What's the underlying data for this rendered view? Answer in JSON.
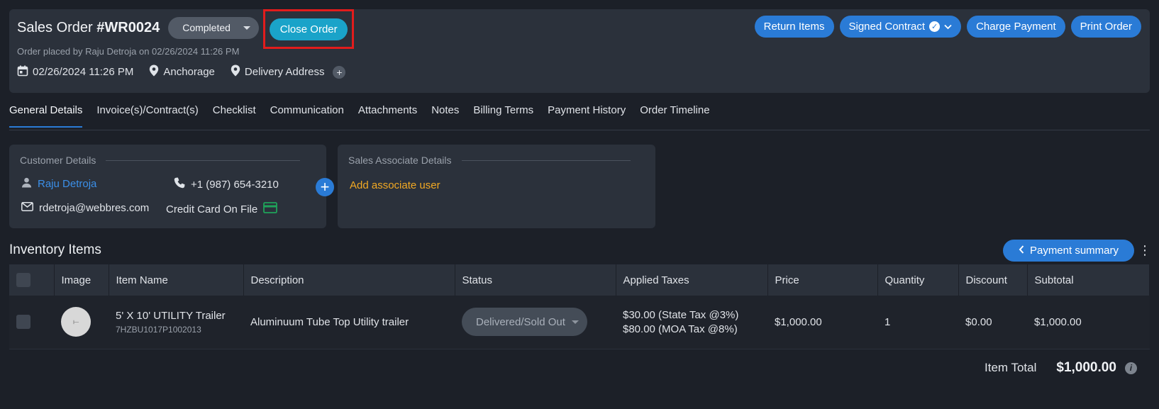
{
  "header": {
    "title_prefix": "Sales Order ",
    "order_number": "#WR0024",
    "status": "Completed",
    "close_button": "Close Order",
    "placed_line": "Order placed by Raju Detroja on 02/26/2024 11:26 PM",
    "date": "02/26/2024 11:26 PM",
    "location": "Anchorage",
    "delivery_address": "Delivery Address",
    "actions": {
      "return_items": "Return Items",
      "signed_contract": "Signed Contract",
      "charge_payment": "Charge Payment",
      "print_order": "Print Order"
    }
  },
  "tabs": [
    "General Details",
    "Invoice(s)/Contract(s)",
    "Checklist",
    "Communication",
    "Attachments",
    "Notes",
    "Billing Terms",
    "Payment History",
    "Order Timeline"
  ],
  "customer": {
    "title": "Customer Details",
    "name": "Raju Detroja",
    "phone": "+1 (987) 654-3210",
    "email": "rdetroja@webbres.com",
    "payment": "Credit Card On File"
  },
  "associate": {
    "title": "Sales Associate Details",
    "add_link": "Add associate user"
  },
  "inventory": {
    "title": "Inventory Items",
    "payment_summary": "Payment summary",
    "columns": [
      "Image",
      "Item Name",
      "Description",
      "Status",
      "Applied Taxes",
      "Price",
      "Quantity",
      "Discount",
      "Subtotal"
    ],
    "rows": [
      {
        "item_name": "5' X 10' UTILITY Trailer",
        "sku": "7HZBU1017P1002013",
        "description": "Aluminuum Tube Top Utility trailer",
        "status": "Delivered/Sold Out",
        "tax1": "$30.00 (State Tax @3%)",
        "tax2": "$80.00 (MOA Tax @8%)",
        "price": "$1,000.00",
        "quantity": "1",
        "discount": "$0.00",
        "subtotal": "$1,000.00"
      }
    ],
    "total_label": "Item Total",
    "total_value": "$1,000.00"
  },
  "colors": {
    "accent": "#2a7bd6",
    "close_button": "#1aa3c9",
    "highlight_box": "#e21c1c",
    "link_orange": "#f2a923",
    "card_green": "#1fa35a"
  },
  "icons": [
    "calendar-icon",
    "location-pin-icon",
    "plus-icon",
    "check-circle-icon",
    "chevron-down-icon",
    "user-icon",
    "phone-icon",
    "mail-icon",
    "credit-card-icon",
    "chevron-left-icon",
    "kebab-menu-icon",
    "info-icon"
  ]
}
